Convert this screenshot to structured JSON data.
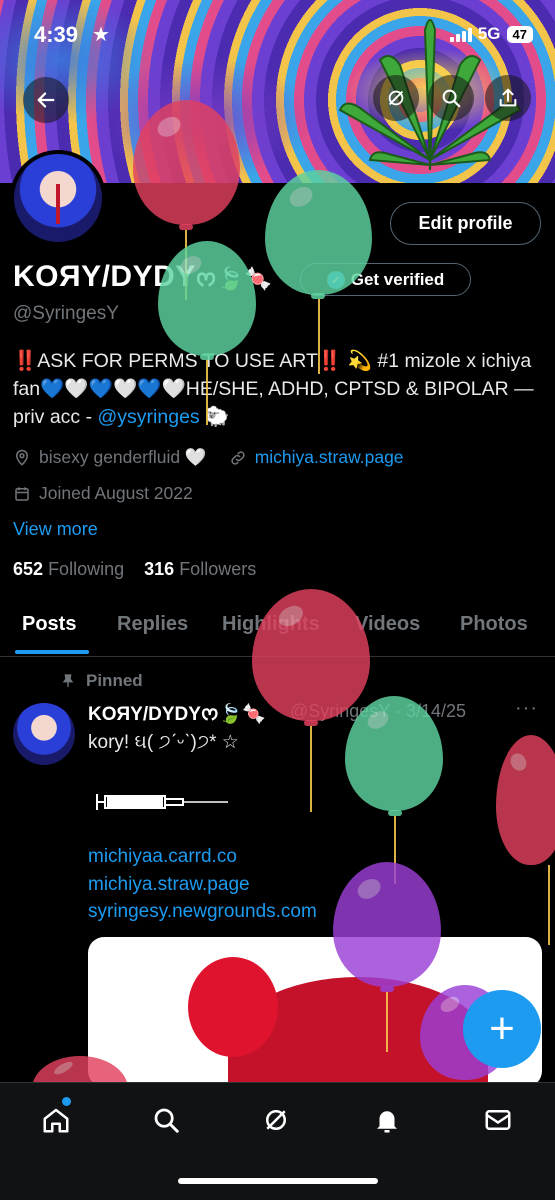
{
  "status_bar": {
    "time": "4:39",
    "network": "5G",
    "battery": "47"
  },
  "header": {
    "edit_profile_label": "Edit profile",
    "get_verified_label": "Get verified"
  },
  "profile": {
    "name": "KOЯY/DYDY",
    "name_suffix": "ᰔ🍃🍬",
    "handle": "@SyringesY",
    "bio_text": "‼️ASK FOR PERMS TO USE ART‼️ 💫 #1 mizole x ichiya fan💙🤍💙🤍💙🤍HE/SHE, ADHD, CPTSD & BIPOLAR —priv acc - ",
    "bio_mention": "@ysyringes",
    "bio_end": " 🐑",
    "location": "bisexy genderfluid 🤍",
    "website": "michiya.straw.page",
    "joined": "Joined August 2022",
    "view_more": "View more",
    "following_count": "652",
    "following_label": "Following",
    "followers_count": "316",
    "followers_label": "Followers"
  },
  "tabs": [
    "Posts",
    "Replies",
    "Highlights",
    "Videos",
    "Photos"
  ],
  "pinned_post": {
    "pinned_label": "Pinned",
    "author_name": "KOЯY/DYDYᰔ🍃🍬",
    "author_handle": "@SyringesY · 3/14/25",
    "more": "···",
    "text": "kory! ઘ( ੭ˊᵕˋ)੭* ☆",
    "links": [
      "michiyaa.carrd.co",
      "michiya.straw.page",
      "syringesy.newgrounds.com"
    ]
  },
  "fab_label": "+",
  "icons": {
    "back": "back-arrow-icon",
    "refresh": "grok-icon",
    "search": "search-icon",
    "share": "share-icon",
    "location": "location-pin-icon",
    "link": "link-icon",
    "calendar": "calendar-icon",
    "pin": "pin-icon",
    "nav": [
      "home-icon",
      "search-icon",
      "grok-icon",
      "notifications-icon",
      "messages-icon"
    ]
  },
  "colors": {
    "accent": "#1d9bf0",
    "background": "#000000",
    "muted_text": "#71767b"
  }
}
